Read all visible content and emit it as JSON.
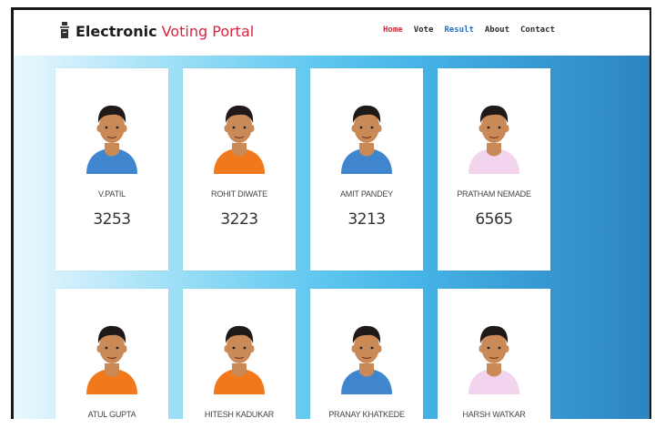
{
  "brand": {
    "part1": "Electronic",
    "part2": "Voting Portal",
    "icon": "ballot-box-icon"
  },
  "nav": [
    "Home",
    "Vote",
    "Result",
    "About",
    "Contact"
  ],
  "colors": {
    "brand_red": "#d9243e",
    "link_active": "#2b6fc2",
    "shirt_blue": "#3f86cf",
    "shirt_orange": "#f2791b",
    "shirt_pink": "#f3d4ee"
  },
  "candidates": [
    {
      "name": "V.PATIL",
      "votes": "3253",
      "shirt": "blue"
    },
    {
      "name": "ROHIT DIWATE",
      "votes": "3223",
      "shirt": "orange"
    },
    {
      "name": "AMIT PANDEY",
      "votes": "3213",
      "shirt": "blue"
    },
    {
      "name": "PRATHAM NEMADE",
      "votes": "6565",
      "shirt": "pink"
    },
    {
      "name": "ATUL GUPTA",
      "votes": "",
      "shirt": "orange"
    },
    {
      "name": "HITESH KADUKAR",
      "votes": "",
      "shirt": "orange"
    },
    {
      "name": "PRANAY KHATKEDE",
      "votes": "",
      "shirt": "blue"
    },
    {
      "name": "HARSH WATKAR",
      "votes": "",
      "shirt": "pink"
    }
  ]
}
